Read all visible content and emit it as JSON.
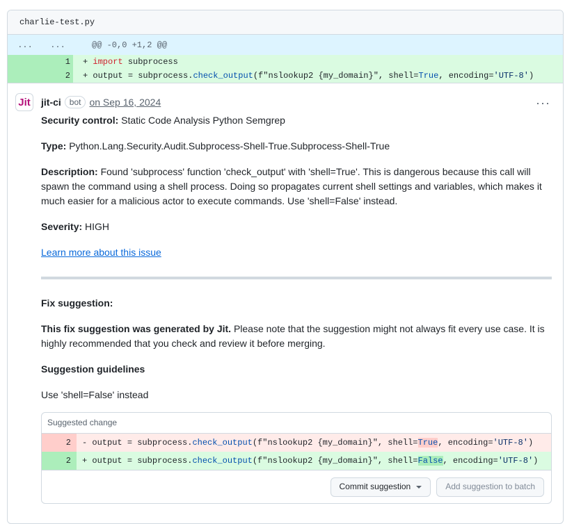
{
  "file": {
    "name": "charlie-test.py",
    "hunk": {
      "old": "...",
      "new": "...",
      "header": "@@ -0,0 +1,2 @@"
    },
    "lines": [
      {
        "num": "1",
        "prefix": "+ ",
        "keyword": "import",
        "rest": " subprocess"
      },
      {
        "num": "2",
        "prefix": "+ ",
        "pre": "output = subprocess.",
        "fn": "check_output",
        "mid": "(f\"nslookup2 {my_domain}\", shell=",
        "val": "True",
        "post": ", encoding=",
        "str": "'UTF-8'",
        "end": ")"
      }
    ]
  },
  "comment": {
    "avatar_text": "Jit",
    "author": "jit-ci",
    "badge": "bot",
    "timestamp": "on Sep 16, 2024",
    "more": "···",
    "security_label": "Security control:",
    "security_value": " Static Code Analysis Python Semgrep",
    "type_label": "Type:",
    "type_value": " Python.Lang.Security.Audit.Subprocess-Shell-True.Subprocess-Shell-True",
    "desc_label": "Description:",
    "desc_value": " Found 'subprocess' function 'check_output' with 'shell=True'. This is dangerous because this call will spawn the command using a shell process. Doing so propagates current shell settings and variables, which makes it much easier for a malicious actor to execute commands. Use 'shell=False' instead.",
    "severity_label": "Severity:",
    "severity_value": " HIGH",
    "learn_more": "Learn more about this issue",
    "fix_heading": "Fix suggestion:",
    "fix_bold": "This fix suggestion was generated by Jit.",
    "fix_text": " Please note that the suggestion might not always fit every use case. It is highly recommended that you check and review it before merging.",
    "guidelines_heading": "Suggestion guidelines",
    "guidelines_text": "Use 'shell=False' instead"
  },
  "suggestion": {
    "title": "Suggested change",
    "del": {
      "num": "2",
      "prefix": "- ",
      "pre": "output = subprocess.",
      "fn": "check_output",
      "mid": "(f\"nslookup2 {my_domain}\", shell=",
      "val": "True",
      "post": ", encoding=",
      "str": "'UTF-8'",
      "end": ")"
    },
    "add": {
      "num": "2",
      "prefix": "+ ",
      "pre": "output = subprocess.",
      "fn": "check_output",
      "mid": "(f\"nslookup2 {my_domain}\", shell=",
      "val": "False",
      "post": ", encoding=",
      "str": "'UTF-8'",
      "end": ")"
    },
    "commit_label": "Commit suggestion",
    "batch_label": "Add suggestion to batch"
  }
}
